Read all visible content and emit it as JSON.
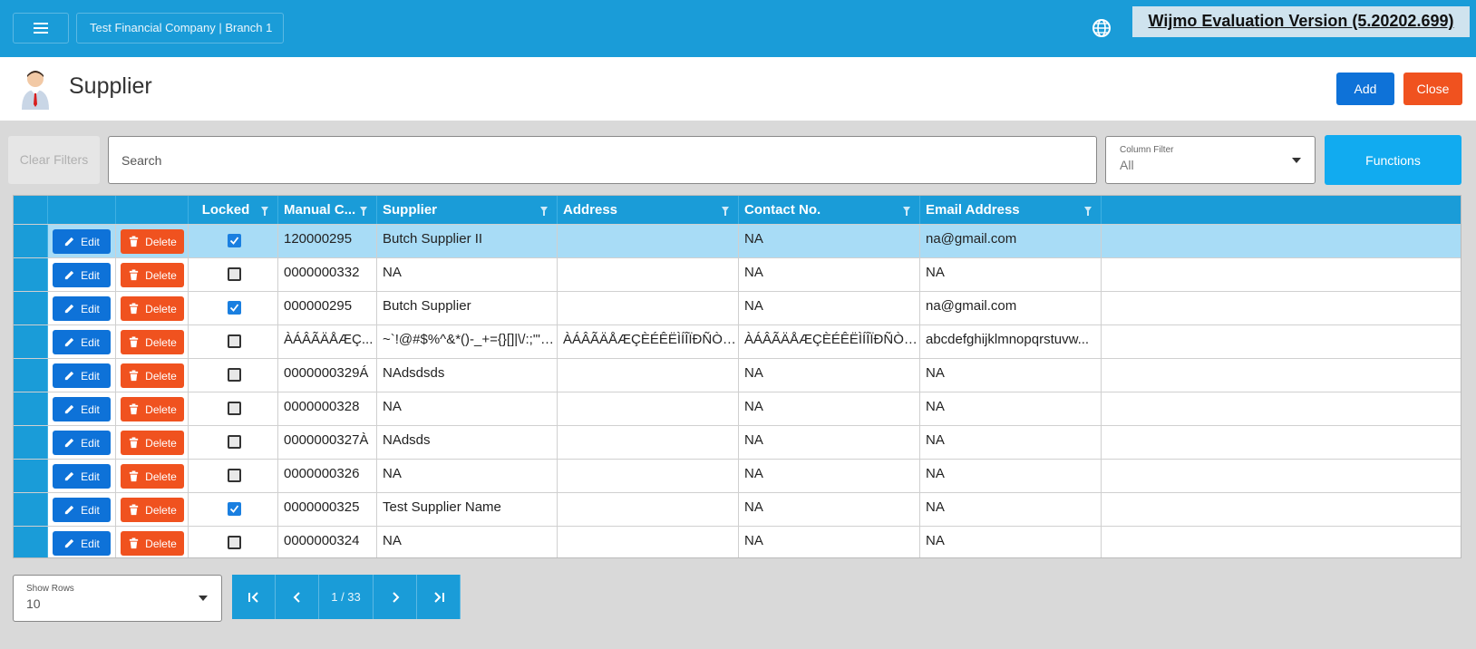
{
  "topbar": {
    "company": "Test Financial Company | Branch 1",
    "watermark": "Wijmo Evaluation Version (5.20202.699)",
    "icons": [
      "menu-icon",
      "globe-icon"
    ]
  },
  "header": {
    "title": "Supplier",
    "add_label": "Add",
    "close_label": "Close"
  },
  "filters": {
    "clear_label": "Clear Filters",
    "search_placeholder": "Search",
    "column_filter_label": "Column Filter",
    "column_filter_value": "All",
    "functions_label": "Functions"
  },
  "grid": {
    "columns": [
      "Locked",
      "Manual C...",
      "Supplier",
      "Address",
      "Contact No.",
      "Email Address"
    ],
    "edit_label": "Edit",
    "delete_label": "Delete",
    "rows": [
      {
        "locked": true,
        "code": "120000295",
        "supplier": "Butch Supplier II",
        "address": "",
        "contact": "NA",
        "email": "na@gmail.com",
        "selected": true
      },
      {
        "locked": false,
        "code": "0000000332",
        "supplier": "NA",
        "address": "",
        "contact": "NA",
        "email": "NA"
      },
      {
        "locked": true,
        "code": "000000295",
        "supplier": "Butch Supplier",
        "address": "",
        "contact": "NA",
        "email": "na@gmail.com"
      },
      {
        "locked": false,
        "code": "ÀÁÂÃÄÅÆÇ...",
        "supplier": "~`!@#$%^&*()-_+={}[]|\\/:;\"'<...",
        "address": "ÀÁÂÃÄÅÆÇÈÉÊËÌÍÎÏÐÑÒÓ...",
        "contact": "ÀÁÂÃÄÅÆÇÈÉÊËÌÍÎÏÐÑÒÓ...",
        "email": "abcdefghijklmnopqrstuvw..."
      },
      {
        "locked": false,
        "code": "0000000329Á",
        "supplier": "NAdsdsds",
        "address": "",
        "contact": "NA",
        "email": "NA"
      },
      {
        "locked": false,
        "code": "0000000328",
        "supplier": "NA",
        "address": "",
        "contact": "NA",
        "email": "NA"
      },
      {
        "locked": false,
        "code": "0000000327À",
        "supplier": "NAdsds",
        "address": "",
        "contact": "NA",
        "email": "NA"
      },
      {
        "locked": false,
        "code": "0000000326",
        "supplier": "NA",
        "address": "",
        "contact": "NA",
        "email": "NA"
      },
      {
        "locked": true,
        "code": "0000000325",
        "supplier": "Test Supplier Name",
        "address": "",
        "contact": "NA",
        "email": "NA"
      },
      {
        "locked": false,
        "code": "0000000324",
        "supplier": "NA",
        "address": "",
        "contact": "NA",
        "email": "NA"
      }
    ]
  },
  "footer": {
    "show_rows_label": "Show Rows",
    "show_rows_value": "10",
    "page_info": "1 / 33"
  },
  "colors": {
    "primary": "#1a9cd8",
    "blue_button": "#0e72d8",
    "orange_button": "#f0521f",
    "functions": "#11abf0",
    "selected_row": "#a8dcf6"
  }
}
